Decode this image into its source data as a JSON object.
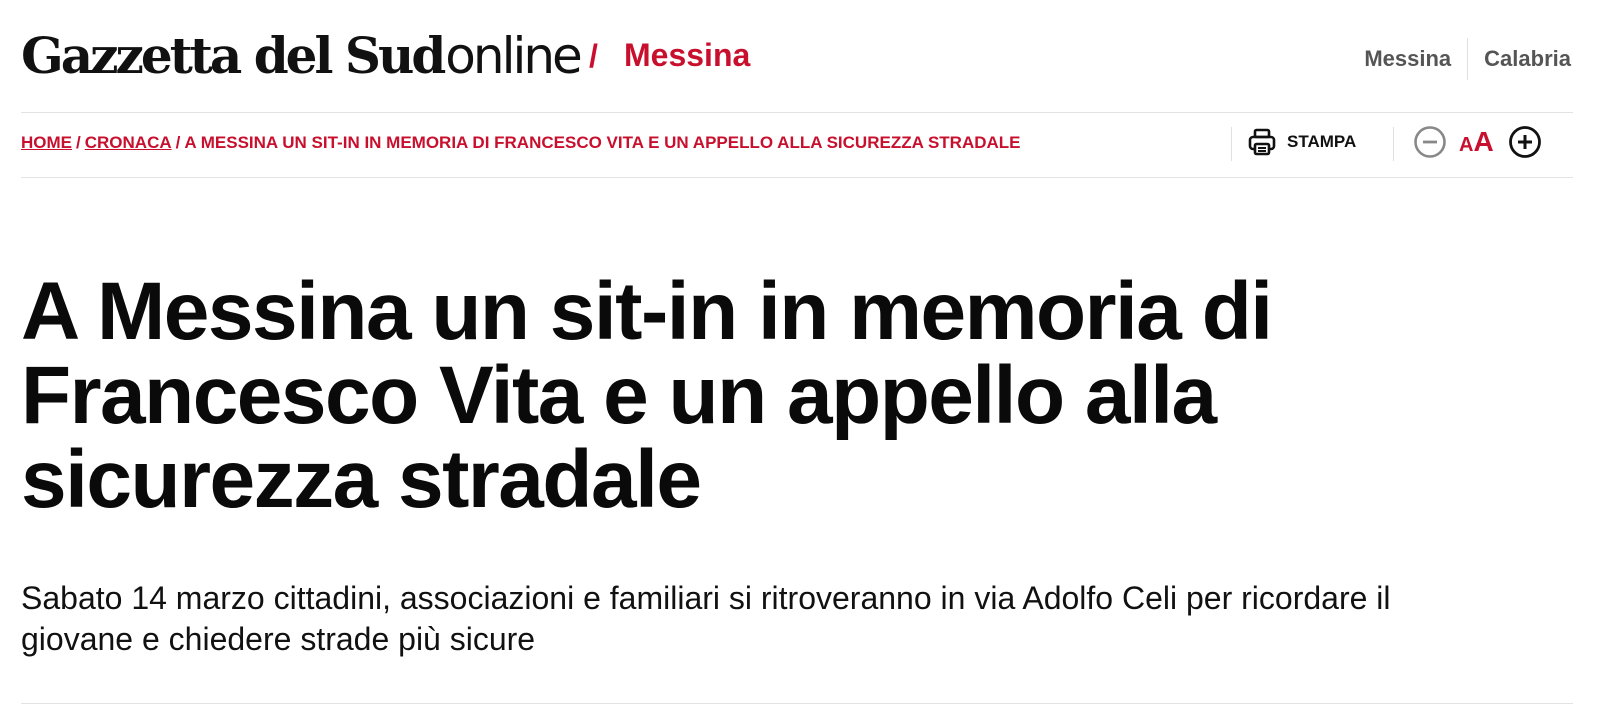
{
  "header": {
    "logo_text": "Gazzetta del Sud",
    "logo_suffix": "online",
    "separator": "/",
    "section": "Messina",
    "nav": [
      "Messina",
      "Calabria"
    ]
  },
  "breadcrumb": {
    "items": [
      "HOME",
      "CRONACA"
    ],
    "current": "A MESSINA UN SIT-IN IN MEMORIA DI FRANCESCO VITA E UN APPELLO ALLA SICUREZZA STRADALE",
    "separator": "/"
  },
  "tools": {
    "print_label": "STAMPA",
    "font_small": "A",
    "font_big": "A"
  },
  "article": {
    "title": "A Messina un sit-in in memoria di Francesco Vita e un appello alla sicurezza stradale",
    "subtitle": "Sabato 14 marzo cittadini, associazioni e familiari si ritroveranno in via Adolfo Celi per ricordare il giovane e chiedere strade più sicure"
  },
  "colors": {
    "accent": "#c8102e",
    "text": "#111111",
    "nav_text": "#555555",
    "divider": "#e3e3e3"
  },
  "icons": [
    "printer-icon",
    "minus-circle-icon",
    "plus-circle-icon"
  ]
}
